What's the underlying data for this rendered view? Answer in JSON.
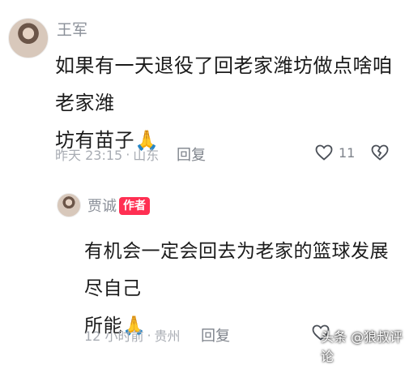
{
  "comments": [
    {
      "author": "王军",
      "text_line1": "如果有一天退役了回老家潍坊做点啥咱老家潍",
      "text_line2": "坊有苗子",
      "emoji": "🙏",
      "time": "昨天 23:15",
      "dot": "·",
      "location": "山东",
      "reply_label": "回复",
      "likes": "11"
    },
    {
      "author": "贾诚",
      "badge": "作者",
      "text_line1": "有机会一定会回去为老家的篮球发展尽自己",
      "text_line2": "所能",
      "emoji": "🙏",
      "time": "12 小时前",
      "dot": "·",
      "location": "贵州",
      "reply_label": "回复"
    }
  ],
  "watermark": "头条 @狼叔评论",
  "icons": {
    "like": "heart-outline-icon",
    "dislike": "broken-heart-icon",
    "praying_hands": "praying-hands-emoji"
  }
}
